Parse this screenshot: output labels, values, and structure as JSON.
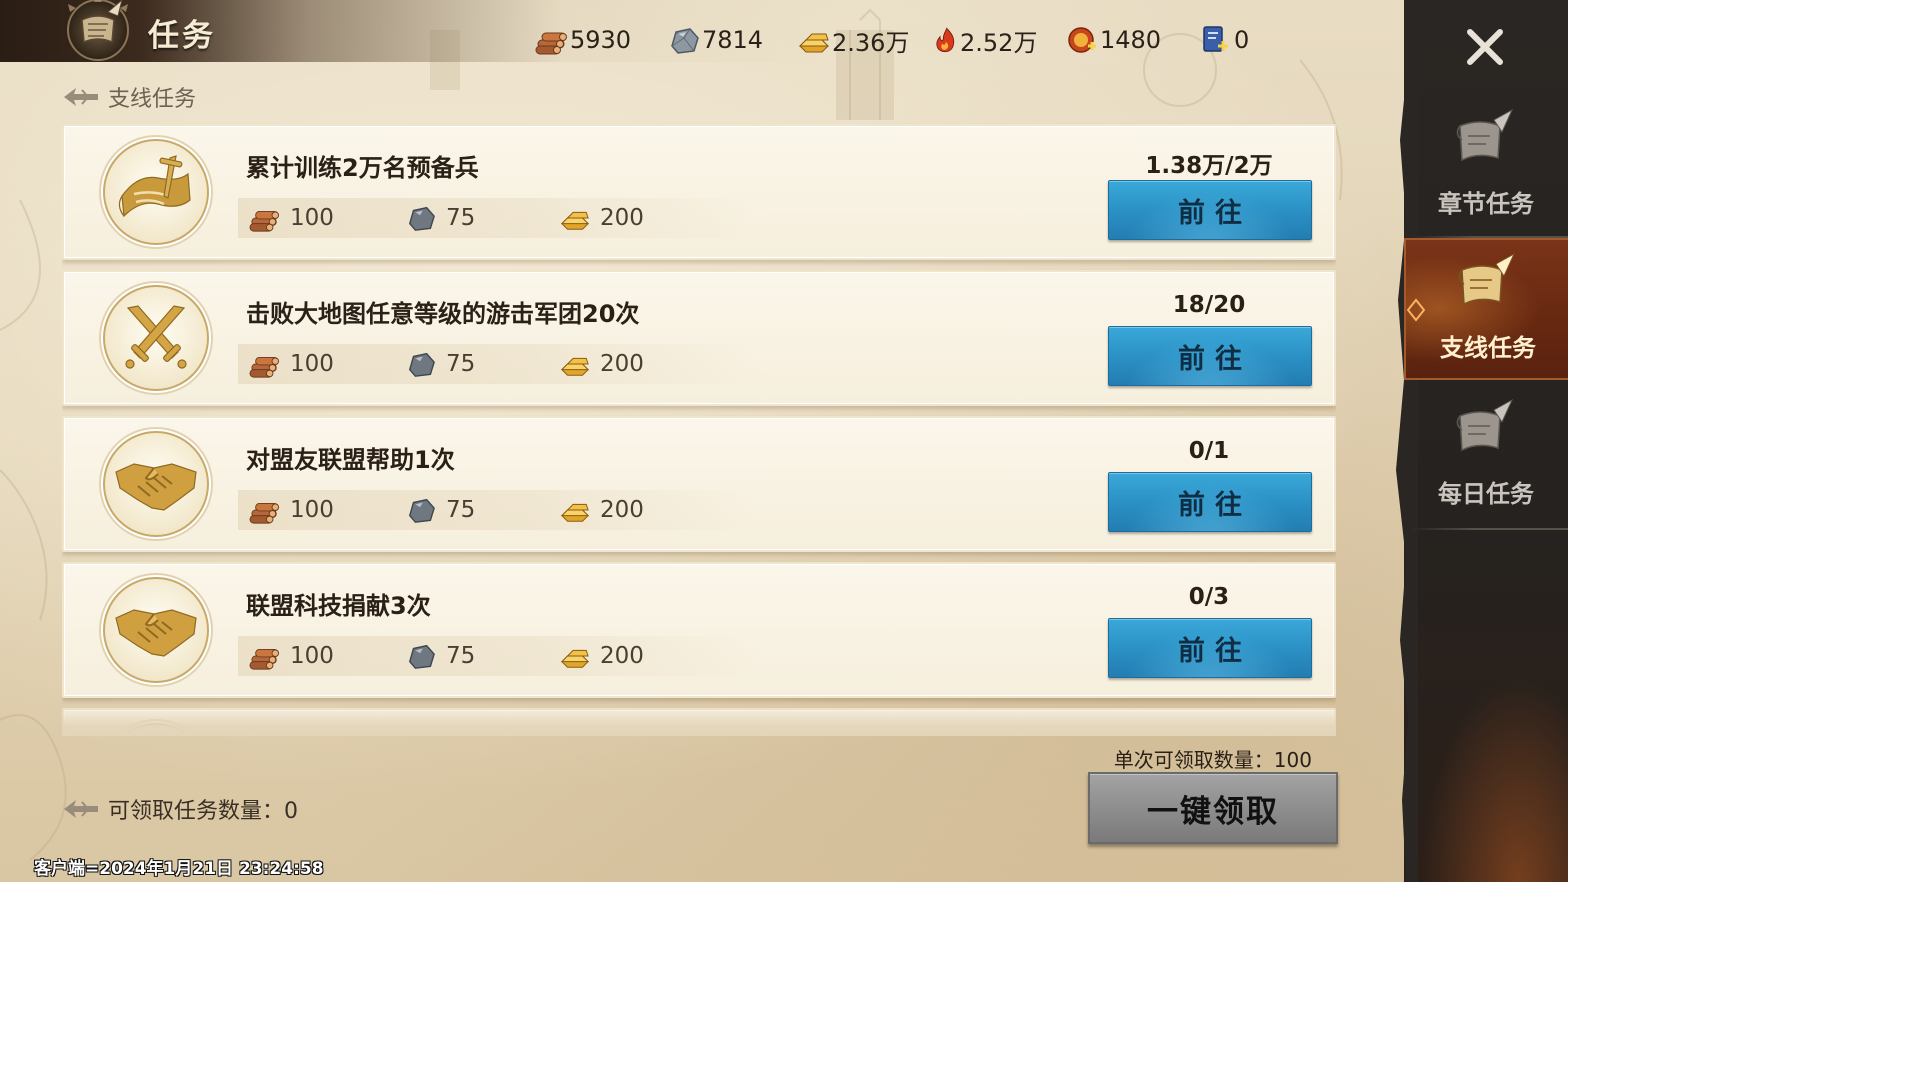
{
  "header": {
    "title": "任务",
    "resources": [
      {
        "icon": "wood-icon",
        "value": "5930"
      },
      {
        "icon": "stone-icon",
        "value": "7814"
      },
      {
        "icon": "gold-icon",
        "value": "2.36万"
      },
      {
        "icon": "fire-icon",
        "value": "2.52万"
      },
      {
        "icon": "medal-icon",
        "value": "1480"
      },
      {
        "icon": "card-plus-icon",
        "value": "0"
      }
    ]
  },
  "section": {
    "label": "支线任务"
  },
  "tasks": [
    {
      "icon": "scroll-sword-icon",
      "title": "累计训练2万名预备兵",
      "rewards": [
        {
          "icon": "wood-icon",
          "value": "100"
        },
        {
          "icon": "stone-icon",
          "value": "75"
        },
        {
          "icon": "gold-icon",
          "value": "200"
        }
      ],
      "progress": "1.38万/2万",
      "button": "前往"
    },
    {
      "icon": "crossed-swords-icon",
      "title": "击败大地图任意等级的游击军团20次",
      "rewards": [
        {
          "icon": "wood-icon",
          "value": "100"
        },
        {
          "icon": "stone-icon",
          "value": "75"
        },
        {
          "icon": "gold-icon",
          "value": "200"
        }
      ],
      "progress": "18/20",
      "button": "前往"
    },
    {
      "icon": "handshake-icon",
      "title": "对盟友联盟帮助1次",
      "rewards": [
        {
          "icon": "wood-icon",
          "value": "100"
        },
        {
          "icon": "stone-icon",
          "value": "75"
        },
        {
          "icon": "gold-icon",
          "value": "200"
        }
      ],
      "progress": "0/1",
      "button": "前往"
    },
    {
      "icon": "handshake-icon",
      "title": "联盟科技捐献3次",
      "rewards": [
        {
          "icon": "wood-icon",
          "value": "100"
        },
        {
          "icon": "stone-icon",
          "value": "75"
        },
        {
          "icon": "gold-icon",
          "value": "200"
        }
      ],
      "progress": "0/3",
      "button": "前往"
    }
  ],
  "footer": {
    "per_claim": "单次可领取数量：100",
    "claim_count": "可领取任务数量：0",
    "claim_all_button": "一键领取",
    "client_time": "客户端=2024年1月21日 23:24:58"
  },
  "sidebar": {
    "tabs": [
      {
        "label": "章节任务",
        "icon": "scroll-quill-icon",
        "active": false
      },
      {
        "label": "支线任务",
        "icon": "scroll-quill-icon",
        "active": true
      },
      {
        "label": "每日任务",
        "icon": "scroll-quill-icon",
        "active": false
      }
    ]
  },
  "colors": {
    "button_blue": "#2a8fc4",
    "active_tab": "#6a2a12",
    "claim_all_disabled": "#8c8c8c",
    "parchment": "#e3d4b6"
  }
}
